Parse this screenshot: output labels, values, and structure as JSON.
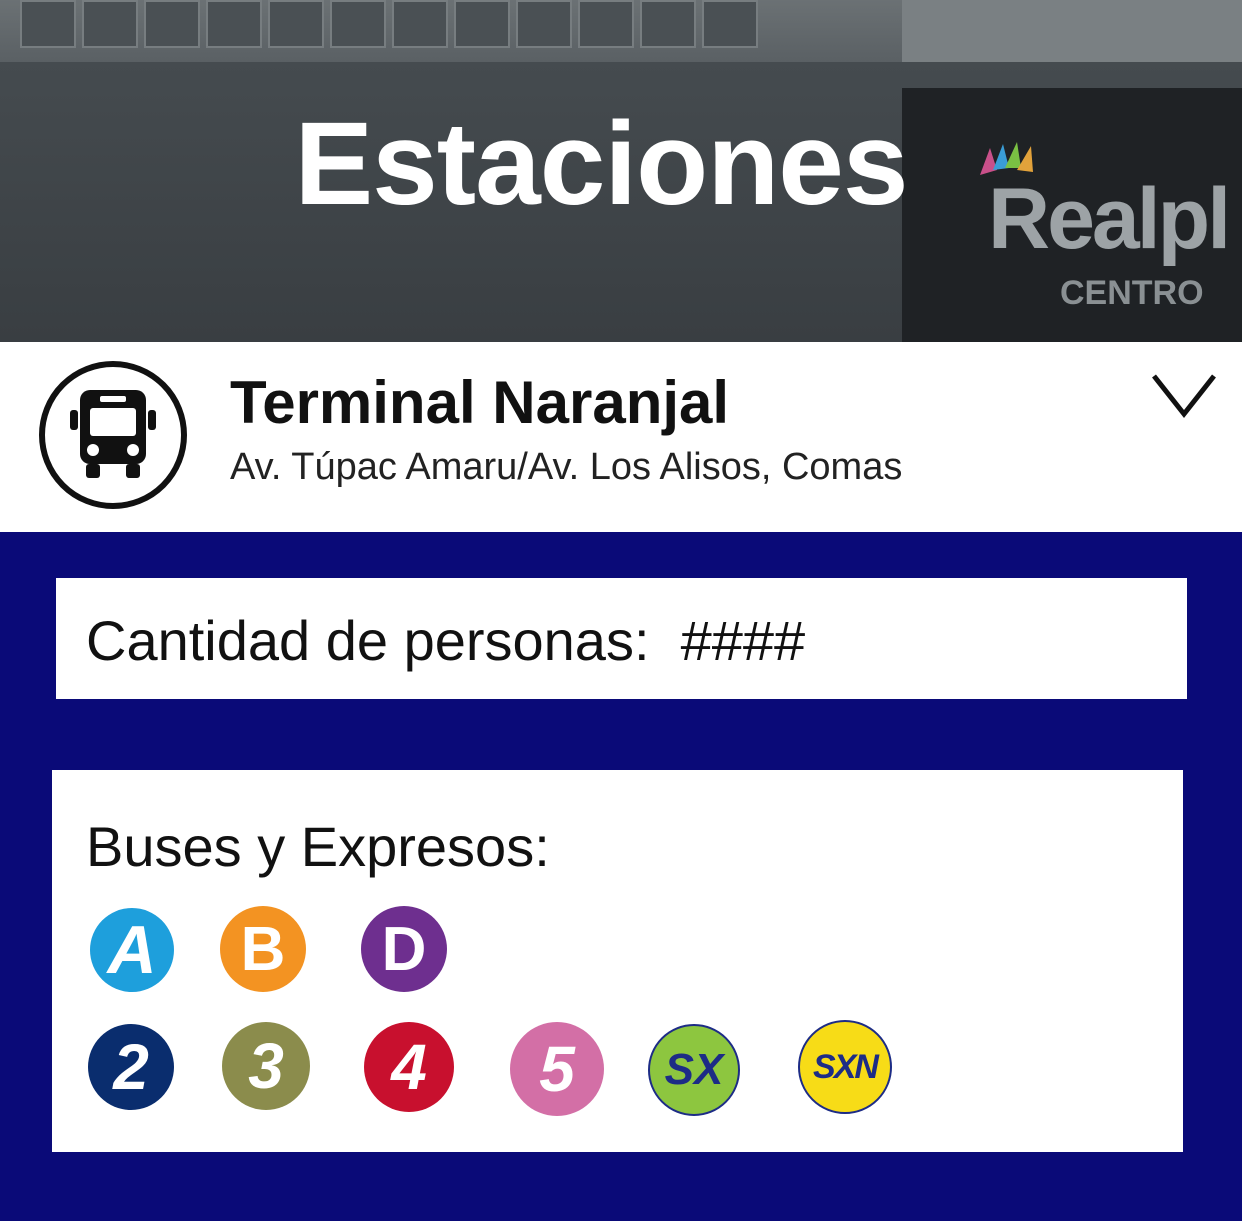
{
  "header": {
    "title": "Estaciones",
    "background_sign": {
      "brand": "Realpl",
      "subtitle": "CENTRO"
    }
  },
  "station": {
    "name": "Terminal Naranjal",
    "address": "Av. Túpac Amaru/Av. Los Alisos, Comas",
    "icon": "bus-icon",
    "expand_icon": "chevron-down-icon"
  },
  "people": {
    "label": "Cantidad de personas:",
    "value": "####"
  },
  "routes": {
    "title": "Buses y Expresos:",
    "row1": [
      {
        "label": "A",
        "color": "#1e9fdc",
        "text_color": "#ffffff"
      },
      {
        "label": "B",
        "color": "#f39322",
        "text_color": "#ffffff"
      },
      {
        "label": "D",
        "color": "#6e2f8f",
        "text_color": "#ffffff"
      }
    ],
    "row2": [
      {
        "label": "2",
        "color": "#0a2d6e",
        "text_color": "#ffffff"
      },
      {
        "label": "3",
        "color": "#8b8c4c",
        "text_color": "#ffffff"
      },
      {
        "label": "4",
        "color": "#c8102e",
        "text_color": "#ffffff"
      },
      {
        "label": "5",
        "color": "#d36fa6",
        "text_color": "#ffffff"
      },
      {
        "label": "SX",
        "color": "#8dc63f",
        "text_color": "#1d2c86"
      },
      {
        "label": "SXN",
        "color": "#f7dc17",
        "text_color": "#1d2c86"
      }
    ]
  },
  "colors": {
    "background": "#0a0a78",
    "card": "#ffffff"
  }
}
